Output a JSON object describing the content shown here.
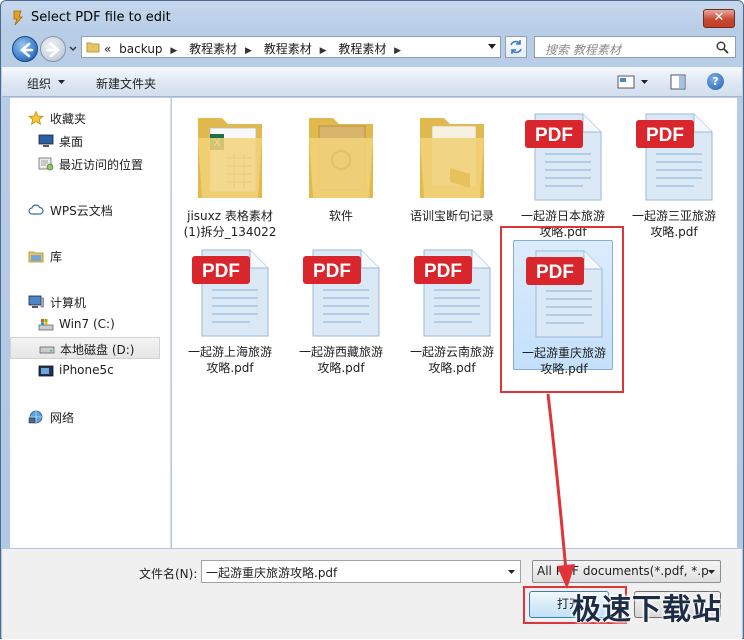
{
  "window": {
    "title": "Select PDF file to edit",
    "close_label": "✕"
  },
  "address": {
    "prefix": "«",
    "crumbs": [
      "backup",
      "教程素材",
      "教程素材",
      "教程素材"
    ]
  },
  "search": {
    "placeholder": "搜索 教程素材"
  },
  "toolbar": {
    "organize_label": "组织",
    "new_folder_label": "新建文件夹",
    "help_label": "?"
  },
  "sidebar": {
    "items": [
      {
        "label": "收藏夹",
        "icon": "star-icon"
      },
      {
        "label": "桌面",
        "icon": "desktop-icon"
      },
      {
        "label": "最近访问的位置",
        "icon": "recent-places-icon"
      },
      {
        "label": "WPS云文档",
        "icon": "cloud-icon"
      },
      {
        "label": "库",
        "icon": "library-icon"
      },
      {
        "label": "计算机",
        "icon": "computer-icon"
      },
      {
        "label": "Win7 (C:)",
        "icon": "system-drive-icon"
      },
      {
        "label": "本地磁盘 (D:)",
        "icon": "drive-icon",
        "selected": true
      },
      {
        "label": "iPhone5c",
        "icon": "phone-icon"
      },
      {
        "label": "网络",
        "icon": "network-icon"
      }
    ]
  },
  "files": [
    {
      "line1": "jisuxz 表格素材",
      "line2": "(1)拆分_134022",
      "kind": "folder-excel"
    },
    {
      "line1": "软件",
      "line2": "",
      "kind": "folder-stamp"
    },
    {
      "line1": "语训宝断句记录",
      "line2": "",
      "kind": "folder"
    },
    {
      "line1": "一起游日本旅游",
      "line2": "攻略.pdf",
      "kind": "pdf"
    },
    {
      "line1": "一起游三亚旅游",
      "line2": "攻略.pdf",
      "kind": "pdf"
    },
    {
      "line1": "一起游上海旅游",
      "line2": "攻略.pdf",
      "kind": "pdf"
    },
    {
      "line1": "一起游西藏旅游",
      "line2": "攻略.pdf",
      "kind": "pdf"
    },
    {
      "line1": "一起游云南旅游",
      "line2": "攻略.pdf",
      "kind": "pdf"
    },
    {
      "line1": "一起游重庆旅游",
      "line2": "攻略.pdf",
      "kind": "pdf",
      "selected": true
    }
  ],
  "pdf_badge": "PDF",
  "bottom": {
    "filename_label": "文件名(N):",
    "filename_value": "一起游重庆旅游攻略.pdf",
    "filetype_value": "All PDF documents(*.pdf, *.p",
    "open_label": "打开",
    "cancel_label": "取消"
  },
  "watermark": "极速下载站",
  "colors": {
    "highlight_red": "#e0343a",
    "selection_blue": "#c4e0fb",
    "pdf_red": "#d9262c"
  }
}
